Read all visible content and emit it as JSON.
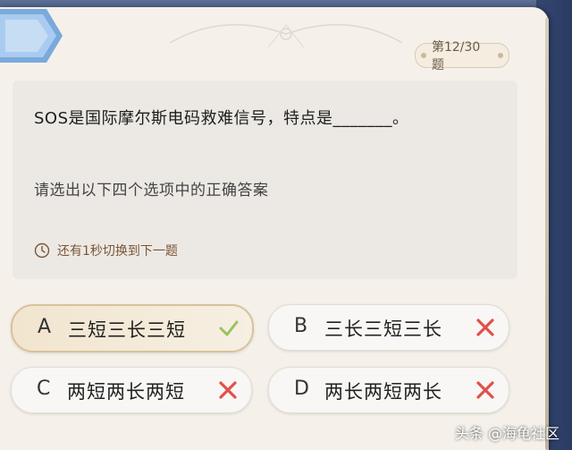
{
  "progress": {
    "label": "第12/30题"
  },
  "question": {
    "text": "SOS是国际摩尔斯电码救难信号，特点是_______。",
    "instruction": "请选出以下四个选项中的正确答案",
    "timer_text": "还有1秒切换到下一题"
  },
  "options": [
    {
      "letter": "A",
      "text": "三短三长三短",
      "status": "correct",
      "selected": true
    },
    {
      "letter": "B",
      "text": "三长三短三长",
      "status": "wrong",
      "selected": false
    },
    {
      "letter": "C",
      "text": "两短两长两短",
      "status": "wrong",
      "selected": false
    },
    {
      "letter": "D",
      "text": "两长两短两长",
      "status": "wrong",
      "selected": false
    }
  ],
  "icons": {
    "correct": "check-icon",
    "wrong": "cross-icon",
    "timer": "clock-icon"
  },
  "colors": {
    "correct_mark": "#9bc35a",
    "wrong_mark": "#e0504a",
    "card_bg": "#f5f1ea",
    "page_bg": "#3a4d75"
  },
  "watermark": "头条 @海龟社区"
}
